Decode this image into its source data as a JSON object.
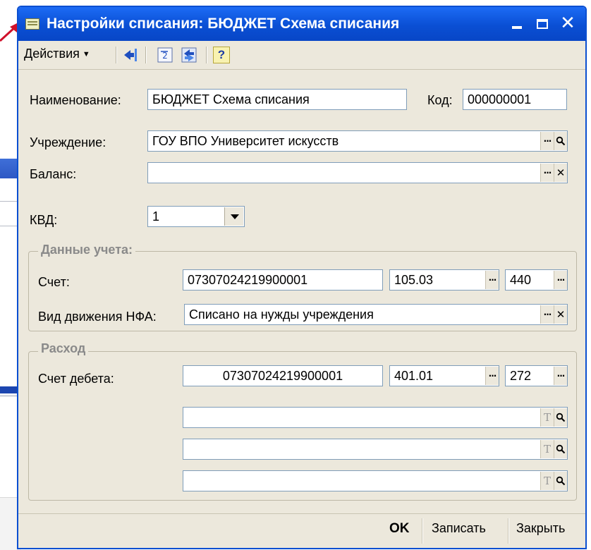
{
  "window": {
    "title": "Настройки списания: БЮДЖЕТ Схема списания",
    "controls": {
      "minimize": "_",
      "maximize": "□",
      "close": "✕"
    }
  },
  "toolbar": {
    "actions_label": "Действия",
    "icons": [
      "back-arrow-icon",
      "exchange-icon",
      "refresh-icon",
      "help-icon"
    ],
    "help_label": "?"
  },
  "form": {
    "name_label": "Наименование:",
    "name_value": "БЮДЖЕТ Схема списания",
    "code_label": "Код:",
    "code_value": "000000001",
    "institution_label": "Учреждение:",
    "institution_value": "ГОУ ВПО Университет искусств",
    "balance_label": "Баланс:",
    "balance_value": "",
    "kvd_label": "КВД:",
    "kvd_value": "1"
  },
  "accounting_group": {
    "title": "Данные учета:",
    "account_label": "Счет:",
    "account_code": "07307024219900001",
    "account_number": "105.03",
    "account_sub": "440",
    "movement_label": "Вид движения НФА:",
    "movement_value": "Списано на нужды учреждения"
  },
  "expense_group": {
    "title": "Расход",
    "debit_label": "Счет дебета:",
    "debit_code": "07307024219900001",
    "debit_account": "401.01",
    "debit_sub": "272",
    "subconto": [
      "",
      "",
      ""
    ]
  },
  "buttons": {
    "ellipsis": "...",
    "clear": "✕",
    "type": "T",
    "ok": "OK",
    "save": "Записать",
    "close": "Закрыть"
  }
}
